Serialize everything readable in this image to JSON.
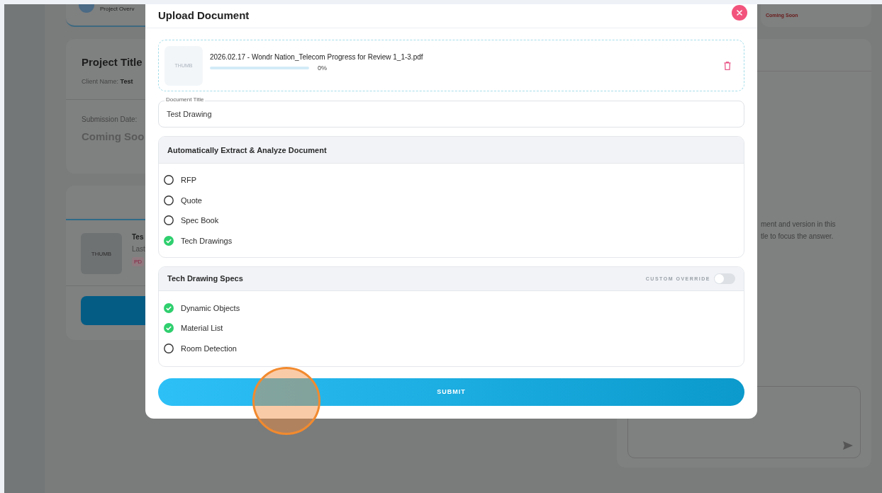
{
  "background": {
    "left": {
      "step_label": "Project Overv",
      "project_title": "Project Title",
      "client_label": "Client Name:",
      "client_value": "Test",
      "submission_label": "Submission Date:",
      "submission_value": "Coming Soo",
      "doc_thumb": "THUMB",
      "doc_name": "Tes",
      "doc_meta": "Last",
      "doc_badge": "PD"
    },
    "right": {
      "status": "Coming Soon",
      "hint_lines": [
        "ment and version in this",
        "tle to focus the answer."
      ]
    }
  },
  "modal": {
    "title": "Upload Document",
    "file": {
      "thumb": "THUMB",
      "name": "2026.02.17 - Wondr Nation_Telecom Progress for Review 1_1-3.pdf",
      "level": 0,
      "percent": "0%"
    },
    "document_title": {
      "label": "Document Title",
      "value": "Test Drawing"
    },
    "extract": {
      "heading": "Automatically Extract & Analyze Document",
      "options": [
        {
          "label": "RFP",
          "selected": false
        },
        {
          "label": "Quote",
          "selected": false
        },
        {
          "label": "Spec Book",
          "selected": false
        },
        {
          "label": "Tech Drawings",
          "selected": true
        }
      ]
    },
    "specs": {
      "heading": "Tech Drawing Specs",
      "override_label": "CUSTOM OVERRIDE",
      "override_on": false,
      "options": [
        {
          "label": "Dynamic Objects",
          "checked": true
        },
        {
          "label": "Material List",
          "checked": true
        },
        {
          "label": "Room Detection",
          "checked": false
        }
      ]
    },
    "submit": "SUBMIT"
  }
}
